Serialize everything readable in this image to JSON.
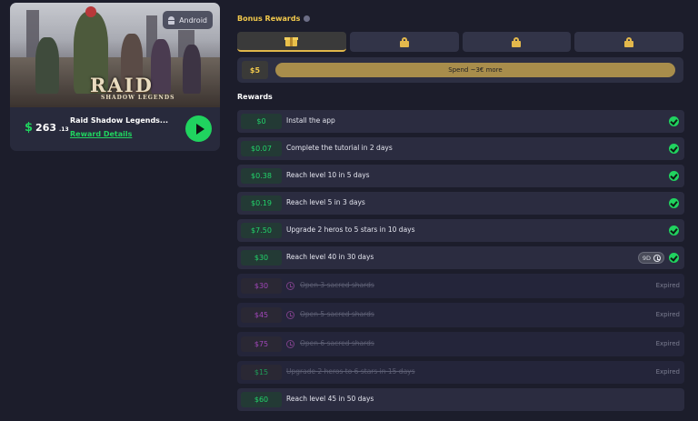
{
  "game": {
    "platform": "Android",
    "banner_logo_main": "RAID",
    "banner_logo_sub": "SHADOW LEGENDS",
    "currency_symbol": "$",
    "amount_int": "263",
    "amount_dec": ".13",
    "title": "Raid Shadow Legends...",
    "details_link": "Reward Details"
  },
  "bonus": {
    "title": "Bonus Rewards",
    "tiers": [
      "gift-icon",
      "lock-icon",
      "lock-icon",
      "lock-icon"
    ],
    "spend_amount": "$5",
    "spend_label": "Spend ~3€ more",
    "accent": "#f2c94c"
  },
  "rewards": {
    "title": "Rewards",
    "rows": [
      {
        "value": "$0",
        "task": "Install the app",
        "status": "done"
      },
      {
        "value": "$0.07",
        "task": "Complete the tutorial in 2 days",
        "status": "done"
      },
      {
        "value": "$0.38",
        "task": "Reach level 10 in 5 days",
        "status": "done"
      },
      {
        "value": "$0.19",
        "task": "Reach level 5 in 3 days",
        "status": "done"
      },
      {
        "value": "$7.50",
        "task": "Upgrade 2 heros to 5 stars in 10 days",
        "status": "done"
      },
      {
        "value": "$30",
        "task": "Reach level 40 in 30 days",
        "status": "done",
        "timer": "9D"
      },
      {
        "value": "$30",
        "task": "Open 3 sacred shards",
        "status": "Expired"
      },
      {
        "value": "$45",
        "task": "Open 5 sacred shards",
        "status": "Expired"
      },
      {
        "value": "$75",
        "task": "Open 6 sacred shards",
        "status": "Expired"
      },
      {
        "value": "$15",
        "task": "Upgrade 2 heros to 6 stars in 15 days",
        "status": "Expired"
      },
      {
        "value": "$60",
        "task": "Reach level 45 in 50 days",
        "status": "pending"
      }
    ]
  },
  "colors": {
    "success": "#20d35f",
    "expired_value": "#a046b8",
    "background": "#1c1d2b"
  }
}
